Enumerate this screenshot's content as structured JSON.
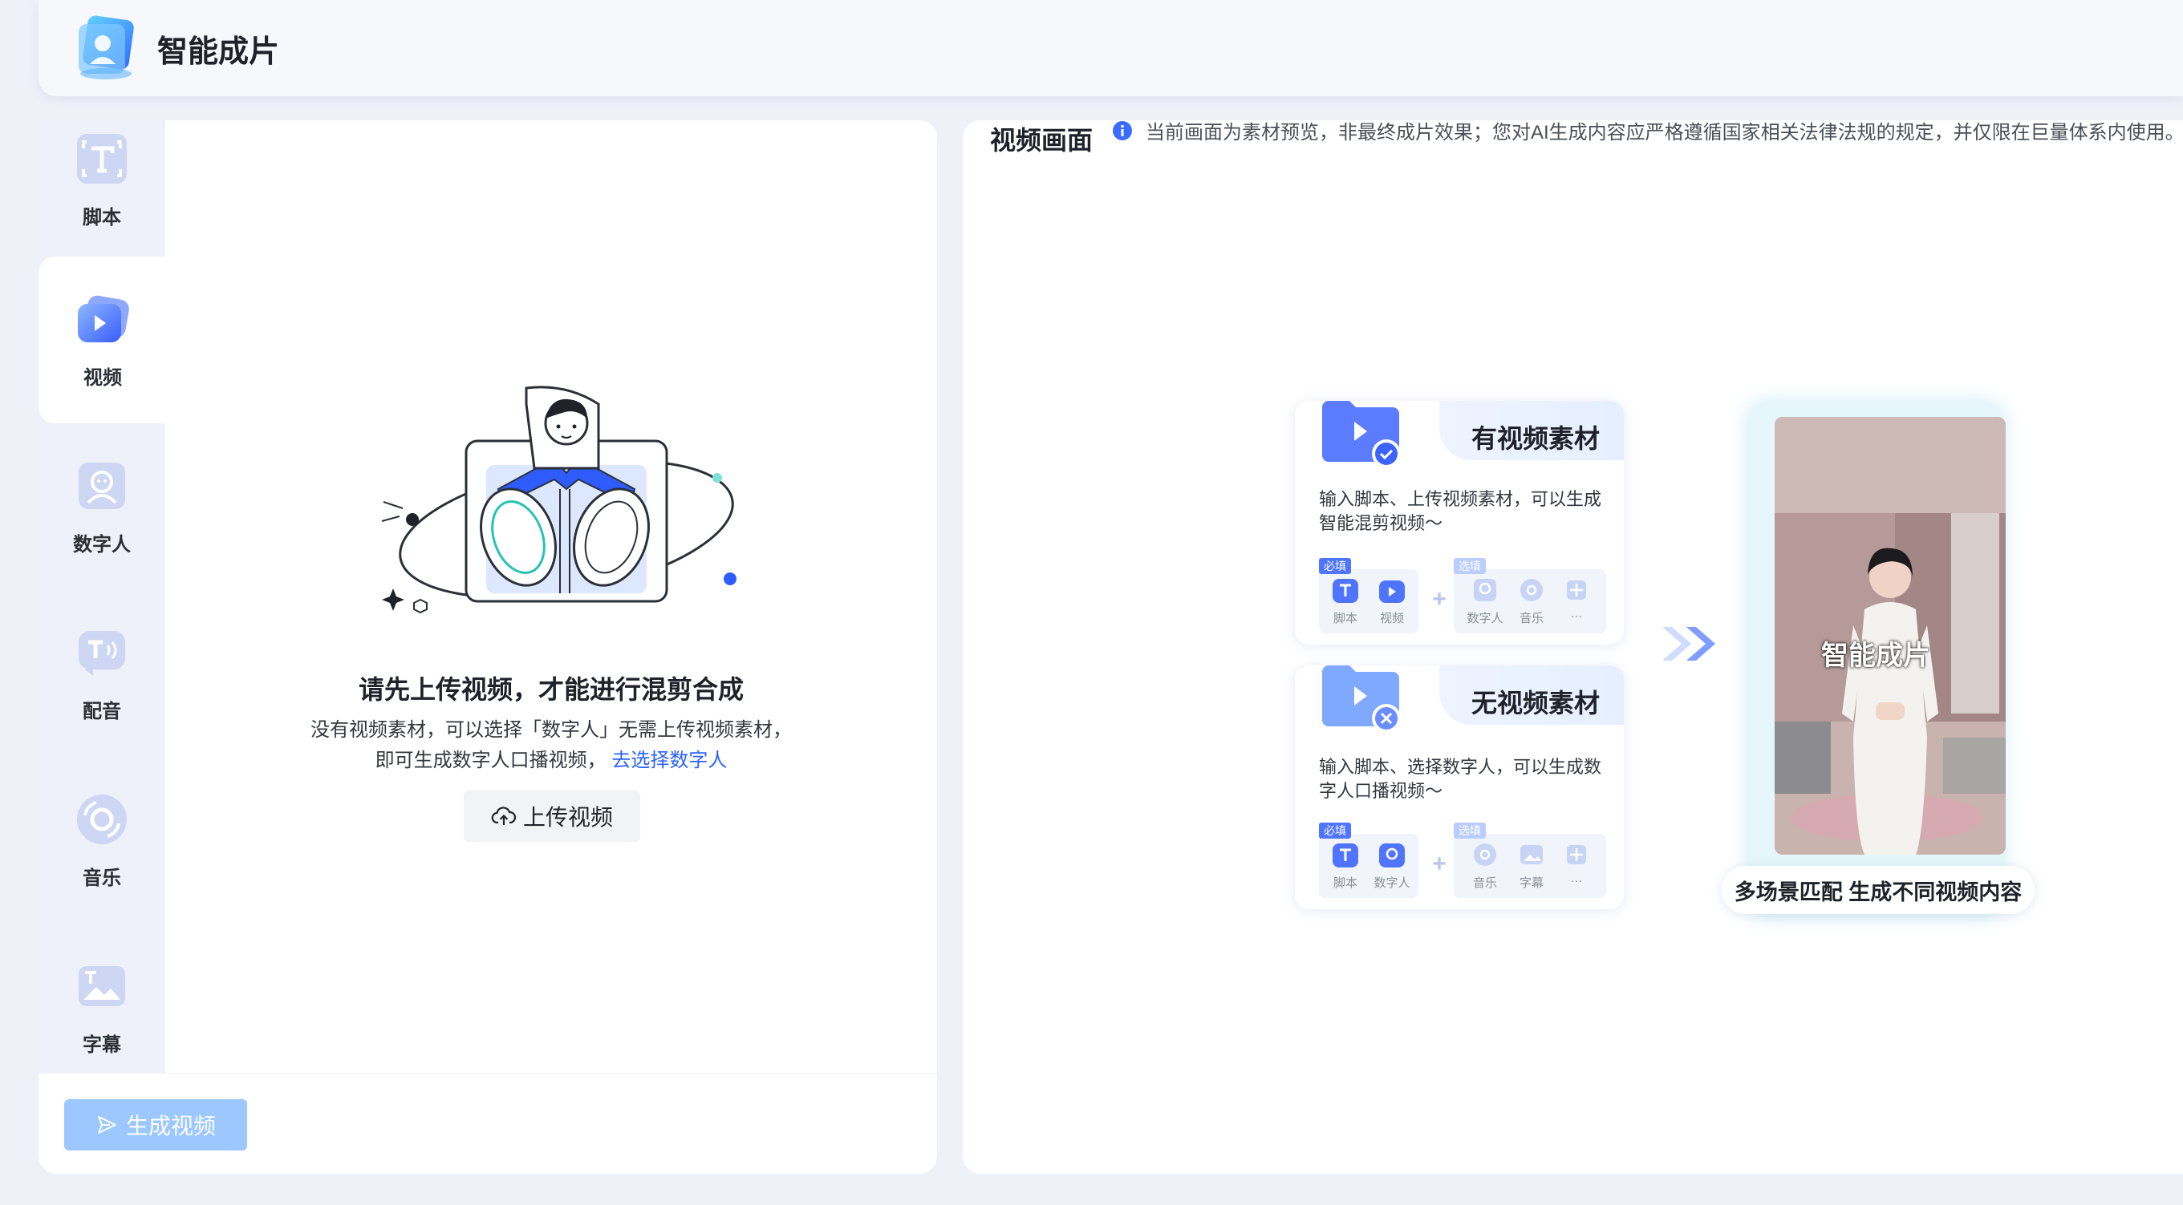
{
  "app": {
    "title": "智能成片"
  },
  "sidebar": {
    "items": [
      {
        "label": "脚本",
        "icon": "script-icon"
      },
      {
        "label": "视频",
        "icon": "video-icon",
        "active": true
      },
      {
        "label": "数字人",
        "icon": "digital-human-icon"
      },
      {
        "label": "配音",
        "icon": "dubbing-icon"
      },
      {
        "label": "音乐",
        "icon": "music-icon"
      },
      {
        "label": "字幕",
        "icon": "subtitle-icon"
      }
    ]
  },
  "left": {
    "empty_title": "请先上传视频，才能进行混剪合成",
    "empty_desc_line1": "没有视频素材，可以选择「数字人」无需上传视频素材，",
    "empty_desc_line2": "即可生成数字人口播视频，",
    "empty_link": "去选择数字人",
    "upload_label": "上传视频",
    "generate_label": "生成视频"
  },
  "preview": {
    "title": "视频画面",
    "notice": "当前画面为素材预览，非最终成片效果；您对AI生成内容应严格遵循国家相关法律法规的规定，并仅限在巨量体系内使用。",
    "cards": [
      {
        "title": "有视频素材",
        "desc": "输入脚本、上传视频素材，可以生成智能混剪视频～",
        "required_tag": "必填",
        "optional_tag": "选填",
        "required": [
          "脚本",
          "视频"
        ],
        "optional": [
          "数字人",
          "音乐",
          "···"
        ]
      },
      {
        "title": "无视频素材",
        "desc": "输入脚本、选择数字人，可以生成数字人口播视频～",
        "required_tag": "必填",
        "optional_tag": "选填",
        "required": [
          "脚本",
          "数字人"
        ],
        "optional": [
          "音乐",
          "字幕",
          "···"
        ]
      }
    ],
    "image_caption": "智能成片",
    "image_subtitle": "多场景匹配 生成不同视频内容"
  },
  "colors": {
    "accent": "#2a62ff",
    "primary_disabled": "#9cc8ff",
    "tag": "#4f74ff"
  }
}
